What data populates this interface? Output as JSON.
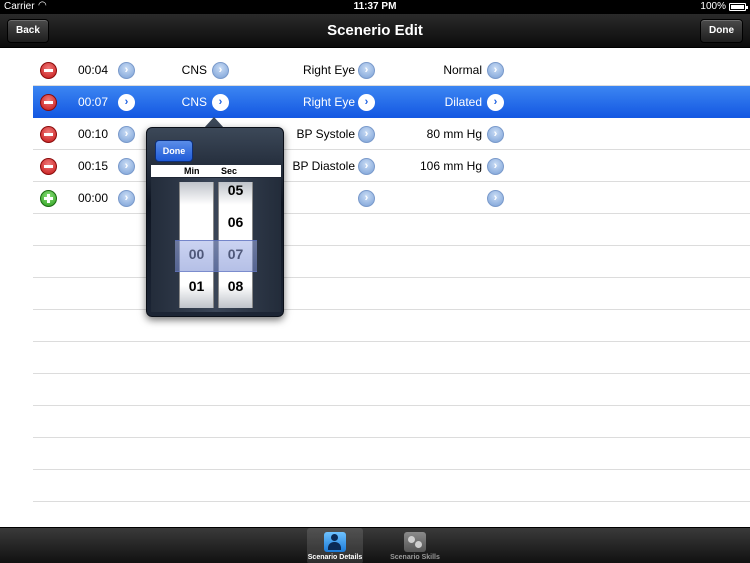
{
  "status_bar": {
    "carrier": "Carrier",
    "time": "11:37 PM",
    "battery": "100%"
  },
  "nav": {
    "title": "Scenerio Edit",
    "back_label": "Back",
    "done_label": "Done"
  },
  "rows": [
    {
      "time": "00:04",
      "category": "CNS",
      "item": "Right Eye",
      "value": "Normal",
      "action": "remove"
    },
    {
      "time": "00:07",
      "category": "CNS",
      "item": "Right Eye",
      "value": "Dilated",
      "action": "remove",
      "selected": true
    },
    {
      "time": "00:10",
      "category": "",
      "item": "BP Systole",
      "value": "80 mm Hg",
      "action": "remove"
    },
    {
      "time": "00:15",
      "category": "",
      "item": "BP Diastole",
      "value": "106 mm Hg",
      "action": "remove"
    },
    {
      "time": "00:00",
      "category": "",
      "item": "",
      "value": "",
      "action": "add"
    }
  ],
  "picker": {
    "done_label": "Done",
    "min_label": "Min",
    "sec_label": "Sec",
    "min_values": [
      "00",
      "01"
    ],
    "sec_values": [
      "05",
      "06",
      "07",
      "08"
    ],
    "selected_min": "00",
    "selected_sec": "07"
  },
  "tabs": [
    {
      "label": "Scenario Details",
      "icon": "people-icon",
      "active": true
    },
    {
      "label": "Scenario Skills",
      "icon": "skills-icon",
      "active": false
    }
  ],
  "colors": {
    "selection": "#1c5fe0",
    "remove": "#c41515",
    "add": "#2a9e1c"
  }
}
